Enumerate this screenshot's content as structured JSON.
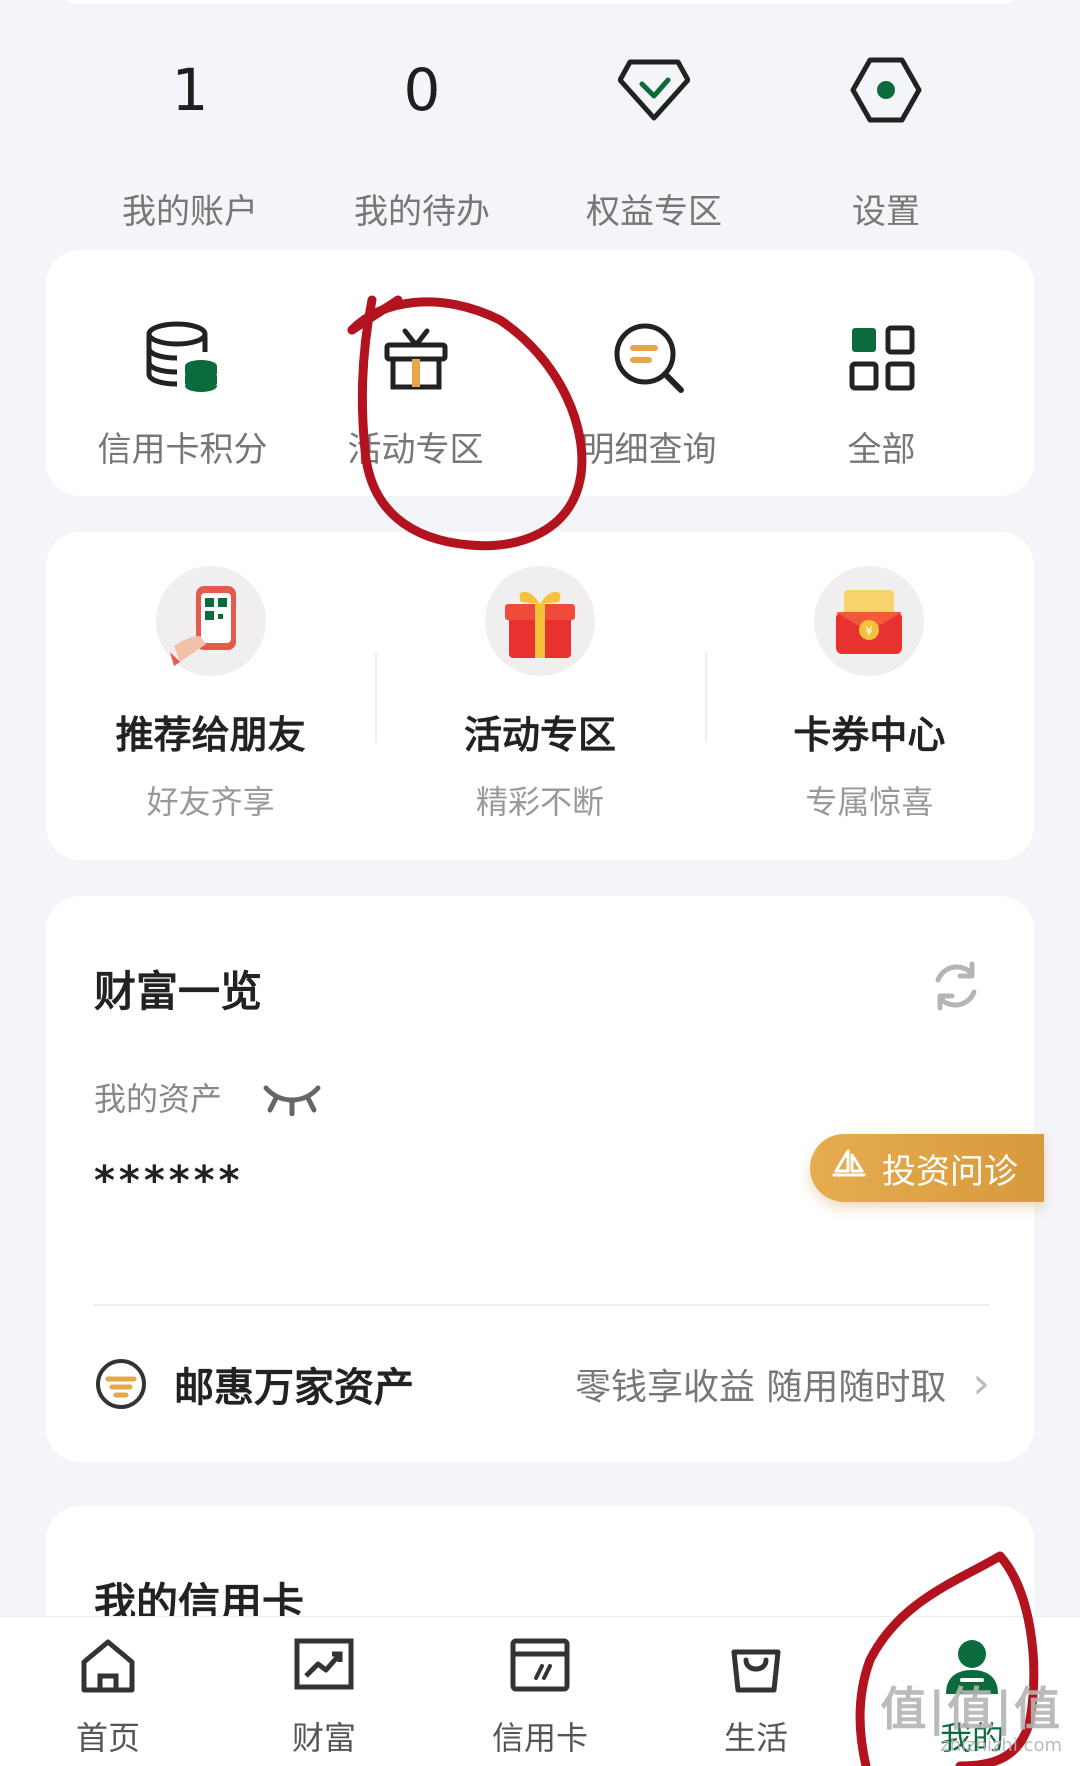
{
  "stats": {
    "accounts_value": "1",
    "accounts_label": "我的账户",
    "todo_value": "0",
    "todo_label": "我的待办",
    "benefits_label": "权益专区",
    "settings_label": "设置"
  },
  "quick": {
    "points_label": "信用卡积分",
    "activity_label": "活动专区",
    "detail_label": "明细查询",
    "all_label": "全部"
  },
  "promo": [
    {
      "title": "推荐给朋友",
      "sub": "好友齐享"
    },
    {
      "title": "活动专区",
      "sub": "精彩不断"
    },
    {
      "title": "卡券中心",
      "sub": "专属惊喜"
    }
  ],
  "wealth": {
    "title": "财富一览",
    "asset_label": "我的资产",
    "asset_masked": "******",
    "product_name": "邮惠万家资产",
    "product_desc": "零钱享收益 随用随时取",
    "invest_label": "投资问诊"
  },
  "credit": {
    "title": "我的信用卡"
  },
  "tabs": [
    {
      "label": "首页"
    },
    {
      "label": "财富"
    },
    {
      "label": "信用卡"
    },
    {
      "label": "生活"
    },
    {
      "label": "我的"
    }
  ],
  "colors": {
    "brand_green": "#0c6b3c",
    "accent_orange": "#e6a64b",
    "annotation_red": "#b3121f"
  },
  "watermark": {
    "line1": "值|值|值",
    "line2": "zhizhizhi.com"
  }
}
